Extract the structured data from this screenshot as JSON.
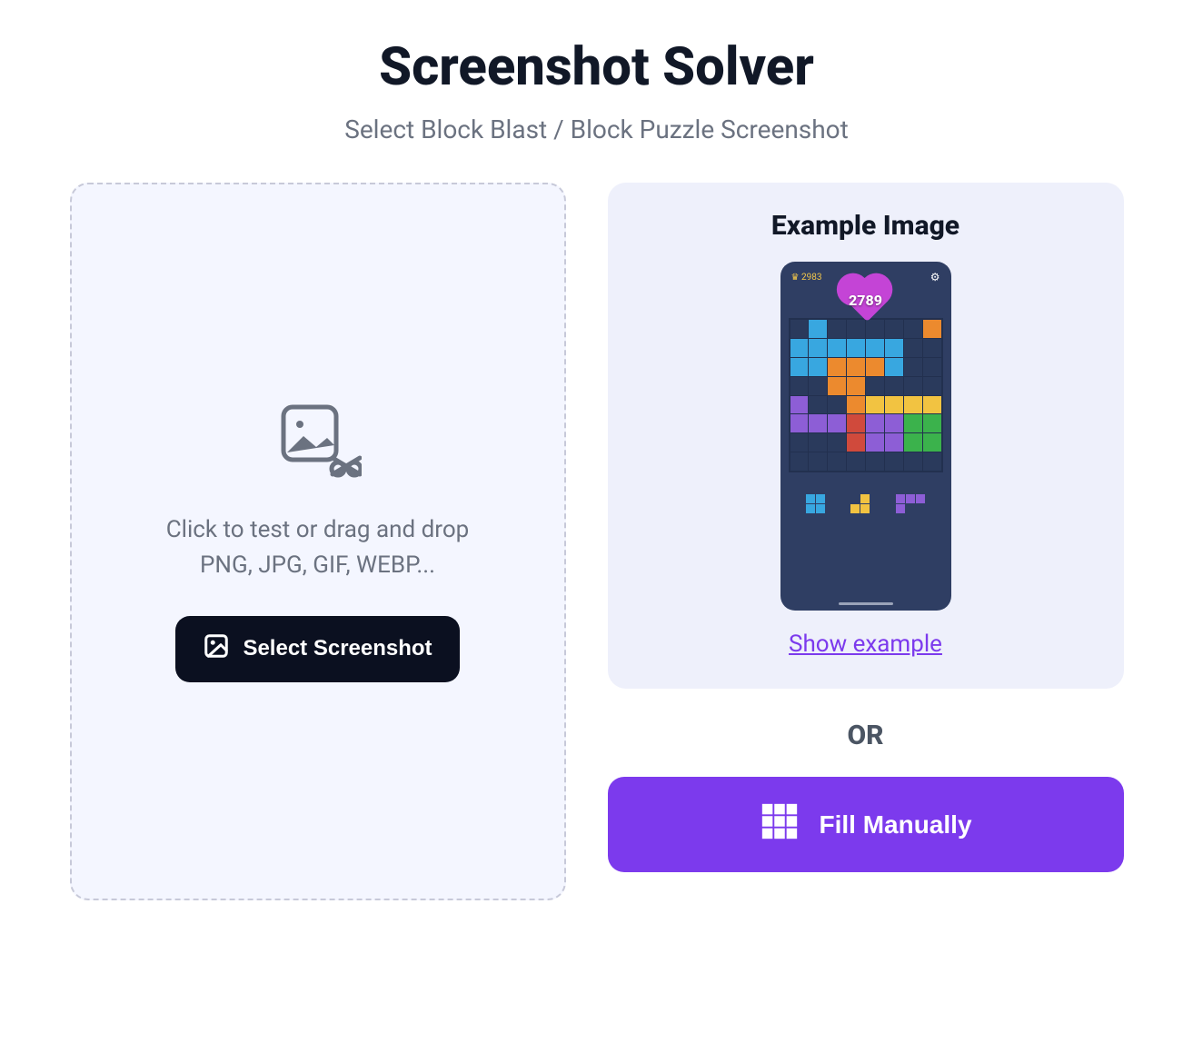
{
  "header": {
    "title": "Screenshot Solver",
    "subtitle": "Select Block Blast / Block Puzzle Screenshot"
  },
  "dropzone": {
    "hint_line1": "Click to test or drag and drop",
    "hint_line2": "PNG, JPG, GIF, WEBP...",
    "button_label": "Select Screenshot"
  },
  "example": {
    "title": "Example Image",
    "crown_score": "2983",
    "heart_score": "2789",
    "show_link": "Show example"
  },
  "or_label": "OR",
  "fill_button": "Fill Manually",
  "board_grid": [
    [
      "",
      "b",
      "",
      "",
      "",
      "",
      "",
      "o"
    ],
    [
      "b",
      "b",
      "b",
      "b",
      "b",
      "b",
      "",
      ""
    ],
    [
      "b",
      "b",
      "o",
      "o",
      "o",
      "b",
      "",
      ""
    ],
    [
      "",
      "",
      "o",
      "o",
      "",
      "",
      "",
      ""
    ],
    [
      "p",
      "",
      "",
      "o",
      "y",
      "y",
      "y",
      "y"
    ],
    [
      "p",
      "p",
      "p",
      "r",
      "p",
      "p",
      "g",
      "g"
    ],
    [
      "",
      "",
      "",
      "r",
      "p",
      "p",
      "g",
      "g"
    ],
    [
      "",
      "",
      "",
      "",
      "",
      "",
      "",
      ""
    ]
  ],
  "colors": {
    "b": "#38a7e0",
    "o": "#ec8a2e",
    "p": "#8d5ed6",
    "y": "#f2c341",
    "g": "#3bb24c",
    "r": "#d04a3c",
    "accent": "#7c3aed",
    "dark": "#0b1020"
  }
}
